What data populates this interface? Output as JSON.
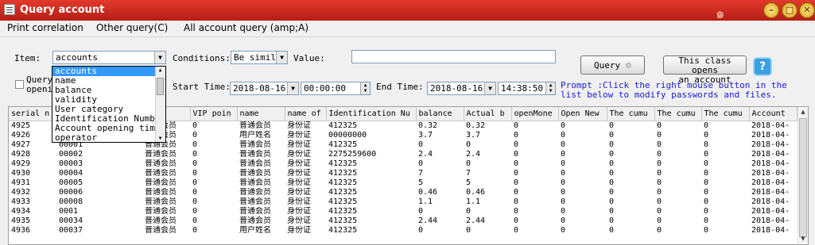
{
  "window": {
    "title": "Query account",
    "min": "–",
    "max": "□",
    "close": "✕"
  },
  "menu": [
    "Print correlation",
    "Other query(C)",
    "All account query (amp;A)"
  ],
  "form": {
    "item_label": "Item:",
    "item_value": "accounts",
    "conditions_label": "Conditions:",
    "conditions_value": "Be simil",
    "value_label": "Value:",
    "value_value": "",
    "query_opening_label": "Query openi",
    "start_time_label": "Start Time:",
    "start_date": "2018-08-16",
    "start_time": "00:00:00",
    "end_time_label": "End Time:",
    "end_date": "2018-08-16",
    "end_time": "14:38:50",
    "query_button": "Query",
    "open_account_button_l1": "This class opens",
    "open_account_button_l2": "an account",
    "help": "?",
    "prompt": "Prompt :Click the right mouse button in the list below to modify passwords and files."
  },
  "dropdown_items": [
    "accounts",
    "name",
    "balance",
    "validity",
    "User category",
    "Identification Number",
    "Account opening time",
    "operator"
  ],
  "columns": [
    "serial n",
    "",
    "s' c",
    "VIP poin",
    "name",
    "name of",
    "Identification Nu",
    "balance",
    "Actual b",
    "openMone",
    "Open New",
    "The cumu",
    "The cumu",
    "The cumu",
    "Account"
  ],
  "rows": [
    [
      "4925",
      "",
      "普通会员",
      "0",
      "普通会员",
      "身份证",
      "412325",
      "0.32",
      "0.32",
      "0",
      "0",
      "0",
      "0",
      "0",
      "2018-04-"
    ],
    [
      "4926",
      "",
      "普通会员",
      "0",
      "用户姓名",
      "身份证",
      "00000000",
      "3.7",
      "3.7",
      "0",
      "0",
      "0",
      "0",
      "0",
      "2018-04-"
    ],
    [
      "4927",
      "00001",
      "普通会员",
      "0",
      "普通会员",
      "身份证",
      "412325",
      "0",
      "0",
      "0",
      "0",
      "0",
      "0",
      "0",
      "2018-04-"
    ],
    [
      "4928",
      "00002",
      "普通会员",
      "0",
      "普通会员",
      "身份证",
      "2275259600",
      "2.4",
      "2.4",
      "0",
      "0",
      "0",
      "0",
      "0",
      "2018-04-"
    ],
    [
      "4929",
      "00003",
      "普通会员",
      "0",
      "普通会员",
      "身份证",
      "412325",
      "0",
      "0",
      "0",
      "0",
      "0",
      "0",
      "0",
      "2018-04-"
    ],
    [
      "4930",
      "00004",
      "普通会员",
      "0",
      "普通会员",
      "身份证",
      "412325",
      "7",
      "7",
      "0",
      "0",
      "0",
      "0",
      "0",
      "2018-04-"
    ],
    [
      "4931",
      "00005",
      "普通会员",
      "0",
      "普通会员",
      "身份证",
      "412325",
      "5",
      "5",
      "0",
      "0",
      "0",
      "0",
      "0",
      "2018-04-"
    ],
    [
      "4932",
      "00006",
      "普通会员",
      "0",
      "普通会员",
      "身份证",
      "412325",
      "0.46",
      "0.46",
      "0",
      "0",
      "0",
      "0",
      "0",
      "2018-04-"
    ],
    [
      "4933",
      "00008",
      "普通会员",
      "0",
      "普通会员",
      "身份证",
      "412325",
      "1.1",
      "1.1",
      "0",
      "0",
      "0",
      "0",
      "0",
      "2018-04-"
    ],
    [
      "4934",
      "0001",
      "普通会员",
      "0",
      "普通会员",
      "身份证",
      "412325",
      "0",
      "0",
      "0",
      "0",
      "0",
      "0",
      "0",
      "2018-04-"
    ],
    [
      "4935",
      "00034",
      "普通会员",
      "0",
      "普通会员",
      "身份证",
      "412325",
      "2.44",
      "2.44",
      "0",
      "0",
      "0",
      "0",
      "0",
      "2018-04-"
    ],
    [
      "4936",
      "00037",
      "普通会员",
      "0",
      "用户姓名",
      "身份证",
      "412325",
      "0",
      "0",
      "0",
      "0",
      "0",
      "0",
      "0",
      "2018-04-"
    ]
  ],
  "colors": {
    "titlebar": "#c8281c",
    "selection": "#3399ff",
    "prompt": "#1a1ad0"
  }
}
